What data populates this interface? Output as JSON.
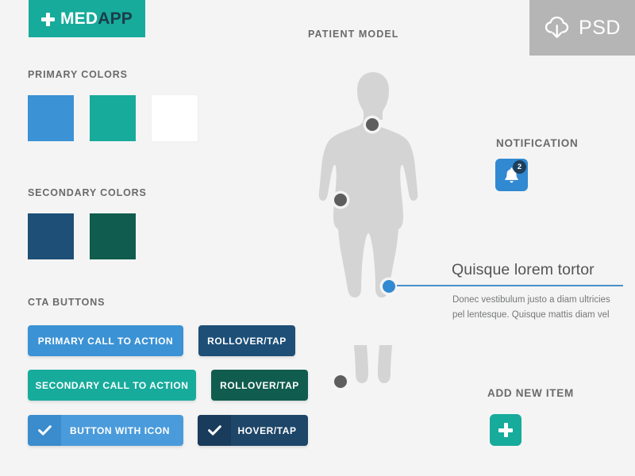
{
  "theme": {
    "background": "#f4f4f4",
    "brand_teal": "#17ab9c",
    "brand_blue": "#3189d1",
    "dark_navy": "#1d4f77",
    "dark_teal": "#105c4e",
    "label_gray": "#6a6a6a"
  },
  "logo": {
    "plus_icon": "plus-icon",
    "text_primary": "MED",
    "text_secondary": "APP"
  },
  "psd_badge": {
    "icon": "cloud-download-icon",
    "label": "PSD"
  },
  "sections": {
    "primary_colors": "PRIMARY COLORS",
    "secondary_colors": "SECONDARY COLORS",
    "cta_buttons": "CTA BUTTONS",
    "patient_model": "PATIENT MODEL",
    "notification": "NOTIFICATION",
    "add_new_item": "ADD NEW ITEM"
  },
  "primary_colors": [
    {
      "name": "primary-blue",
      "hex": "#3b92d4"
    },
    {
      "name": "primary-teal",
      "hex": "#17ab9c"
    },
    {
      "name": "primary-white",
      "hex": "#ffffff"
    }
  ],
  "secondary_colors": [
    {
      "name": "secondary-navy",
      "hex": "#1d4f77"
    },
    {
      "name": "secondary-teal",
      "hex": "#105c4e"
    }
  ],
  "cta_buttons": [
    {
      "name": "primary-call-to-action",
      "label": "PRIMARY CALL TO ACTION",
      "bg": "#3b92d4",
      "icon": null
    },
    {
      "name": "primary-rollover-tap",
      "label": "ROLLOVER/TAP",
      "bg": "#1d4f77",
      "icon": null
    },
    {
      "name": "secondary-call-to-action",
      "label": "SECONDARY CALL TO ACTION",
      "bg": "#17ab9c",
      "icon": null
    },
    {
      "name": "secondary-rollover-tap",
      "label": "ROLLOVER/TAP",
      "bg": "#105c4e",
      "icon": null
    },
    {
      "name": "button-with-icon",
      "label": "BUTTON WITH ICON",
      "bg": "#4a9bdb",
      "icon_bg": "#3a8ccc",
      "icon": "check-icon"
    },
    {
      "name": "hover-tap-with-icon",
      "label": "HOVER/TAP",
      "bg": "#1d4668",
      "icon_bg": "#1a3c5c",
      "icon": "check-icon"
    }
  ],
  "patient_model": {
    "silhouette_color": "#d4d4d4",
    "markers": [
      {
        "name": "marker-neck",
        "state": "inactive",
        "color": "#5e5e5e"
      },
      {
        "name": "marker-abdomen",
        "state": "inactive",
        "color": "#5e5e5e"
      },
      {
        "name": "marker-knee",
        "state": "active",
        "color": "#3189d1"
      },
      {
        "name": "marker-ankle",
        "state": "inactive",
        "color": "#5e5e5e"
      }
    ]
  },
  "callout": {
    "title": "Quisque lorem tortor",
    "body": "Donec vestibulum justo a diam ultricies pel lentesque. Quisque mattis diam vel",
    "line_color": "#4a90c9"
  },
  "notification": {
    "icon": "bell-icon",
    "count": "2",
    "button_color": "#3189d1",
    "badge_color": "#1d3f5c"
  },
  "add_item": {
    "icon": "plus-icon",
    "button_color": "#17ab9c"
  }
}
